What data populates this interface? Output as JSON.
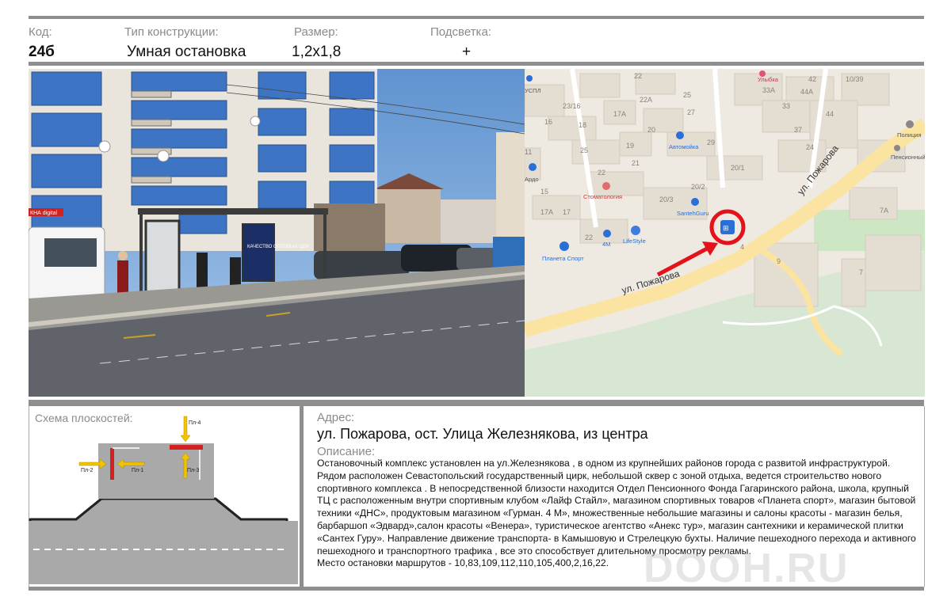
{
  "header": {
    "code_label": "Код:",
    "code_value": "24б",
    "type_label": "Тип конструкции:",
    "type_value": "Умная остановка",
    "size_label": "Размер:",
    "size_value": "1,2x1,8",
    "light_label": "Подсветка:",
    "light_value": "+"
  },
  "photo": {
    "store_sign": "КНА digital",
    "ad_text": "КАЧЕСТВО ОПТОВЫХ ЦЕН"
  },
  "map": {
    "street_main": "ул. Пожарова",
    "street_side": "ул. Пожарова",
    "pois": [
      {
        "label": "Улыбка"
      },
      {
        "label": "Полиция"
      },
      {
        "label": "Пенсионный фонд РФ"
      },
      {
        "label": "Автомойка"
      },
      {
        "label": "Стоматология"
      },
      {
        "label": "SantehGuru"
      },
      {
        "label": "Планета Спорт"
      },
      {
        "label": "LifeStyle"
      },
      {
        "label": "4M"
      },
      {
        "label": "Ардо"
      },
      {
        "label": "УСПЛ"
      }
    ],
    "house_numbers": [
      "22",
      "42",
      "10/39",
      "33А",
      "44А",
      "33",
      "44",
      "22А",
      "25",
      "23/16",
      "17А",
      "27",
      "18",
      "37",
      "16",
      "25",
      "20",
      "24",
      "19",
      "29",
      "21",
      "11",
      "20/1",
      "15",
      "22",
      "20/3",
      "20/2",
      "17А",
      "17",
      "22",
      "7А",
      "9",
      "7",
      "4"
    ],
    "accent_color": "#e3121b",
    "bus_stop_icon_color": "#2a6fd6"
  },
  "scheme": {
    "title": "Схема плоскостей:",
    "planes": [
      "Пл-1",
      "Пл-2",
      "Пл-3",
      "Пл-4"
    ],
    "plane_color": "#d42020",
    "arrow_color": "#f2c300"
  },
  "address": {
    "label": "Адрес:",
    "value": "ул. Пожарова, ост. Улица Железнякова, из центра"
  },
  "description": {
    "label": "Описание:",
    "text": "Остановочный комплекс установлен на ул.Железнякова , в одном из крупнейших районов города с развитой инфраструктурой. Рядом расположен  Севастопольский государственный цирк, небольшой сквер с зоной отдыха,  ведется строительство нового спортивного комплекса . В непосредственной близости находится  Отдел Пенсионного Фонда Гагаринского района, школа, крупный ТЦ  с расположенным внутри спортивным клубом «Лайф Стайл»,  магазином спортивных товаров «Планета спорт», магазин  бытовой техники «ДНС», продуктовым магазином «Гурман. 4 М», множественные небольшие магазины и салоны красоты - магазин белья, барбаршоп «Эдвард»,салон красоты «Венера», туристическое агентство «Анекс тур», магазин сантехники и керамической плитки «Сантех Гуру». Направление движение транспорта-  в Камышовую и Стрелецкую бухты. Наличие пешеходного перехода и  активного пешеходного и транспортного трафика , все это способствует длительному просмотру рекламы.",
    "routes": "Место остановки  маршрутов - 10,83,109,112,110,105,400,2,16,22."
  },
  "watermark": "DOOH.RU"
}
